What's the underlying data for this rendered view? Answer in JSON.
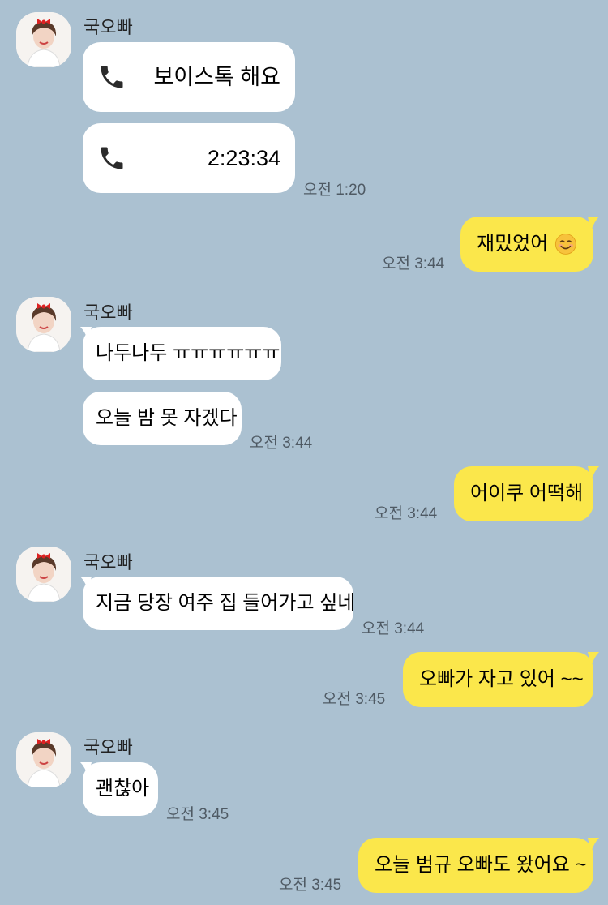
{
  "contact": {
    "name": "국오빠"
  },
  "messages": {
    "m1_call_label": "보이스톡 해요",
    "m2_call_duration": "2:23:34",
    "m2_time": "오전 1:20",
    "m3_text": "재밌었어",
    "m3_time": "오전 3:44",
    "m4_text": "나두나두 ㅠㅠㅠㅠㅠㅠ",
    "m5_text": "오늘 밤 못 자겠다",
    "m5_time": "오전 3:44",
    "m6_text": "어이쿠 어떡해",
    "m6_time": "오전 3:44",
    "m7_text": "지금 당장 여주 집 들어가고 싶네",
    "m7_time": "오전 3:44",
    "m8_text": "오빠가 자고 있어 ~~",
    "m8_time": "오전 3:45",
    "m9_text": "괜찮아",
    "m9_time": "오전 3:45",
    "m10_text": "오늘 범규 오빠도 왔어요 ~",
    "m10_time": "오전 3:45"
  },
  "icons": {
    "call": "phone-icon",
    "emoji": "smiling-face-emoji-icon",
    "avatar": "profile-photo"
  },
  "colors": {
    "background": "#abc1d1",
    "incoming_bubble": "#ffffff",
    "outgoing_bubble": "#fbe74b",
    "timestamp": "#4f5a64"
  }
}
